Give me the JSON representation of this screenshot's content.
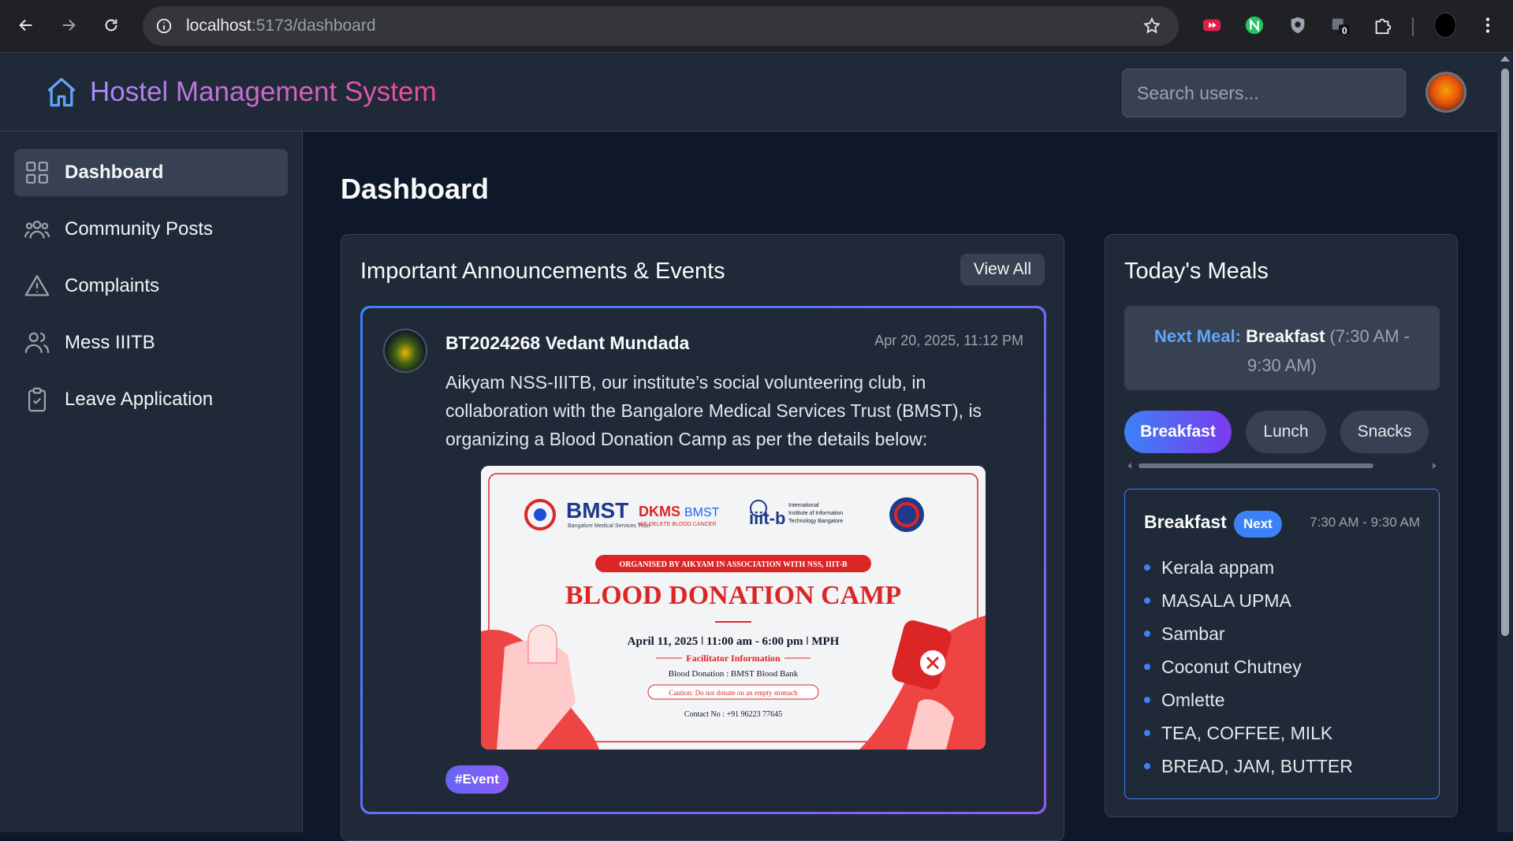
{
  "browser": {
    "url_host": "localhost",
    "url_path": ":5173/dashboard",
    "extension_badge": "0"
  },
  "header": {
    "title": "Hostel Management System",
    "search_placeholder": "Search users..."
  },
  "sidebar": {
    "items": [
      {
        "label": "Dashboard",
        "icon": "grid-icon",
        "active": true
      },
      {
        "label": "Community Posts",
        "icon": "users-group-icon"
      },
      {
        "label": "Complaints",
        "icon": "warning-triangle-icon"
      },
      {
        "label": "Mess IIITB",
        "icon": "users-icon"
      },
      {
        "label": "Leave Application",
        "icon": "clipboard-check-icon"
      }
    ]
  },
  "main": {
    "title": "Dashboard",
    "announcements": {
      "title": "Important Announcements & Events",
      "view_all": "View All",
      "post": {
        "author": "BT2024268 Vedant Mundada",
        "time": "Apr 20, 2025, 11:12 PM",
        "text": "Aikyam NSS-IIITB, our institute’s social volunteering club, in collaboration with the Bangalore Medical Services Trust (BMST), is organizing a Blood Donation Camp as per the details below:",
        "tag": "#Event",
        "poster": {
          "logo_bmst": "BMST",
          "logo_bmst_sub": "Bangalore Medical Services Trust",
          "logo_dkms": "DKMS",
          "logo_dkms2": "BMST",
          "logo_dkms_sub": "WE DELETE BLOOD CANCER",
          "logo_iiitb": "iiit-b",
          "logo_iiitb_sub1": "International",
          "logo_iiitb_sub2": "Institute of Information",
          "logo_iiitb_sub3": "Technology Bangalore",
          "organised": "ORGANISED BY AIKYAM IN ASSOCIATION WITH NSS, IIIT-B",
          "headline": "BLOOD DONATION CAMP",
          "details": "April 11, 2025 ǀ  11:00 am - 6:00 pm ǀ  MPH",
          "facilitator": "Facilitator Information",
          "blood_bank": "Blood Donation : BMST Blood Bank",
          "caution": "Caution: Do not donate on an empty stomach",
          "contact": "Contact No : +91 96223 77645"
        }
      }
    },
    "meals": {
      "title": "Today's Meals",
      "next_label": "Next Meal:",
      "next_meal": "Breakfast",
      "next_range": "(7:30 AM - 9:30 AM)",
      "tabs": [
        "Breakfast",
        "Lunch",
        "Snacks"
      ],
      "card": {
        "name": "Breakfast",
        "badge": "Next",
        "time": "7:30 AM - 9:30 AM",
        "items": [
          "Kerala appam",
          "MASALA UPMA",
          "Sambar",
          "Coconut Chutney",
          "Omlette",
          "TEA, COFFEE, MILK",
          "BREAD, JAM, BUTTER"
        ]
      }
    }
  },
  "colors": {
    "accent_blue": "#3b82f6",
    "accent_purple": "#8b5cf6",
    "brand_gradient_start": "#a78bfa",
    "brand_gradient_end": "#ec4899",
    "poster_red": "#dc2626"
  }
}
